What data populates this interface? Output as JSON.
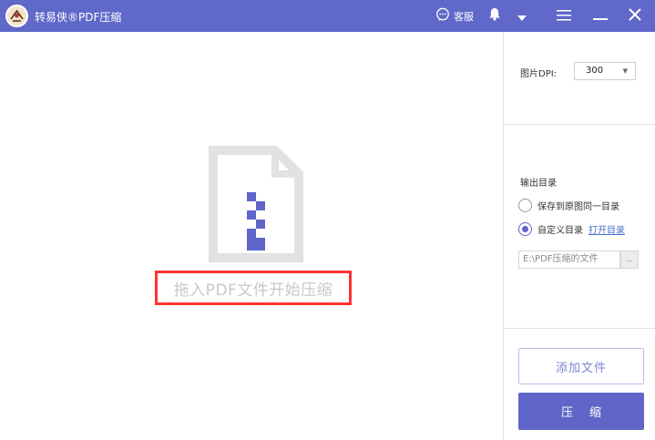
{
  "titlebar": {
    "app_title": "转易侠®PDF压缩",
    "support_label": "客服",
    "icons": [
      "chat-icon",
      "bell-icon",
      "chevron-down-icon",
      "hamburger-menu-icon",
      "minimize-icon",
      "close-icon"
    ]
  },
  "drop_area": {
    "hint": "拖入PDF文件开始压缩",
    "icon": "zip-file-icon"
  },
  "settings": {
    "dpi_label": "图片DPI:",
    "dpi_value": "300",
    "output_label": "输出目录",
    "option_same": "保存到原图同一目录",
    "option_custom": "自定义目录",
    "open_dir": "打开目录",
    "selected_option": "custom",
    "path_value": "E:\\PDF压缩的文件",
    "browse_label": ".."
  },
  "actions": {
    "add_file": "添加文件",
    "compress": "压缩"
  },
  "colors": {
    "accent": "#6068c9",
    "highlight_border": "#ff3333",
    "link": "#4a6fd0"
  }
}
